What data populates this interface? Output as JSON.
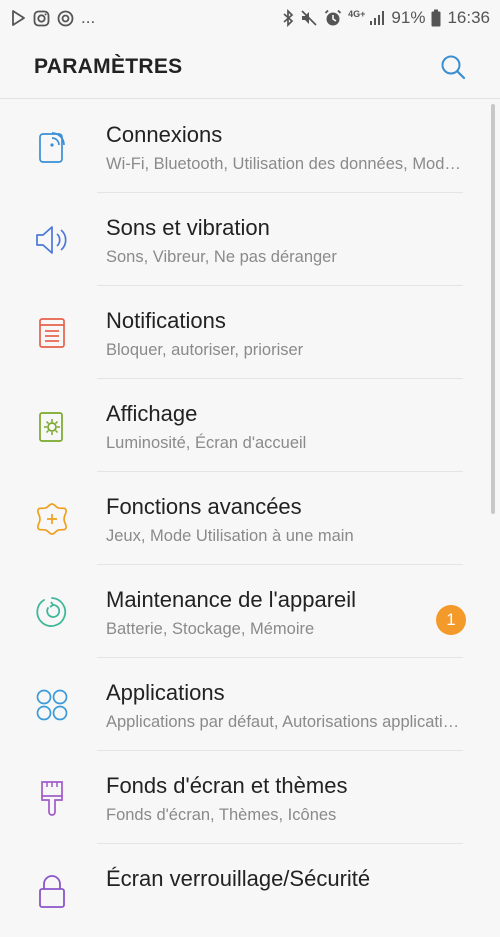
{
  "status_bar": {
    "more": "...",
    "battery_pct": "91%",
    "time": "16:36",
    "network": "4G+",
    "left_icons": [
      "play-store-icon",
      "instagram-icon",
      "sync-app-icon"
    ],
    "right_icons": [
      "bluetooth-icon",
      "vibrate-mute-icon",
      "alarm-icon",
      "signal-icon",
      "battery-icon"
    ]
  },
  "header": {
    "title": "PARAMÈTRES",
    "search_icon": "search-icon"
  },
  "items": [
    {
      "title": "Connexions",
      "subtitle": "Wi-Fi, Bluetooth, Utilisation des données, Mode Avion",
      "icon": "connections-icon",
      "color": "#3b8fd6"
    },
    {
      "title": "Sons et vibration",
      "subtitle": "Sons, Vibreur, Ne pas déranger",
      "icon": "volume-icon",
      "color": "#4a78d8"
    },
    {
      "title": "Notifications",
      "subtitle": "Bloquer, autoriser, prioriser",
      "icon": "notifications-icon",
      "color": "#e8604c"
    },
    {
      "title": "Affichage",
      "subtitle": "Luminosité, Écran d'accueil",
      "icon": "display-icon",
      "color": "#7aa82b"
    },
    {
      "title": "Fonctions avancées",
      "subtitle": "Jeux, Mode Utilisation à une main",
      "icon": "advanced-features-icon",
      "color": "#f0a020"
    },
    {
      "title": "Maintenance de l'appareil",
      "subtitle": "Batterie, Stockage, Mémoire",
      "icon": "device-maintenance-icon",
      "color": "#3fb89a",
      "badge": "1"
    },
    {
      "title": "Applications",
      "subtitle": "Applications par défaut, Autorisations applications",
      "icon": "applications-icon",
      "color": "#3b9bd8"
    },
    {
      "title": "Fonds d'écran et thèmes",
      "subtitle": "Fonds d'écran, Thèmes, Icônes",
      "icon": "wallpaper-brush-icon",
      "color": "#a05bc8"
    },
    {
      "title": "Écran verrouillage/Sécurité",
      "subtitle": "",
      "icon": "lock-icon",
      "color": "#8a55c8"
    }
  ],
  "colors": {
    "badge": "#f39a2b",
    "search": "#3a8fd0"
  }
}
